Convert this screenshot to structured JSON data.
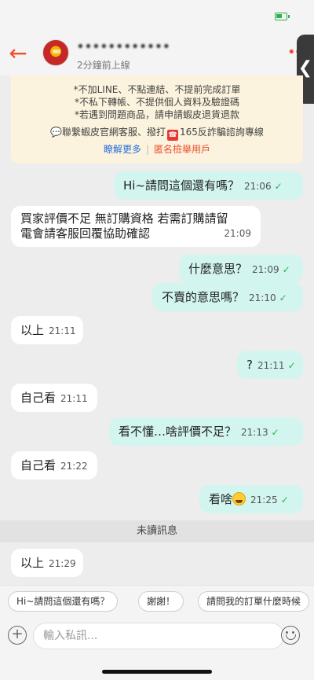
{
  "header": {
    "username": "••••••••••••",
    "last_seen": "2分鐘前上線"
  },
  "notice": {
    "line1": "*不加LINE、不點連結、不提前完成訂單",
    "line2": "*不私下轉帳、不提供個人資料及驗證碼",
    "line3": "*若遇到問題商品，請申請蝦皮退貨退款",
    "contact_before": "聯繫蝦皮官網客服、撥打",
    "contact_after": "165反詐騙諮詢專線",
    "learn_more": "瞭解更多",
    "report": "匿名檢舉用戶"
  },
  "messages": [
    {
      "text": "Hi~請問這個還有嗎？",
      "time": "21:06"
    },
    {
      "text": "買家評價不足 無訂購資格 若需訂購請留",
      "text2": "電會請客服回覆協助確認",
      "time": "21:09"
    },
    {
      "text": "什麼意思？",
      "time": "21:09"
    },
    {
      "text": "不賣的意思嗎？",
      "time": "21:10"
    },
    {
      "text": "以上",
      "time": "21:11"
    },
    {
      "text": "?",
      "time": "21:11"
    },
    {
      "text": "自己看",
      "time": "21:11"
    },
    {
      "text": "看不懂…啥評價不足？",
      "time": "21:13"
    },
    {
      "text": "自己看",
      "time": "21:22"
    },
    {
      "text": "看啥",
      "time": "21:25"
    },
    {
      "text": "以上",
      "time": "21:29"
    }
  ],
  "unread_label": "未讀訊息",
  "quick_replies": [
    "Hi~請問這個還有嗎？",
    "謝謝！",
    "請問我的訂單什麼時候"
  ],
  "composer": {
    "placeholder": "輸入私訊..."
  },
  "colors": {
    "accent": "#ee4d2d",
    "outgoing_bubble": "#d2f5ef",
    "incoming_bubble": "#ffffff",
    "read_tick": "#2bb24c"
  }
}
